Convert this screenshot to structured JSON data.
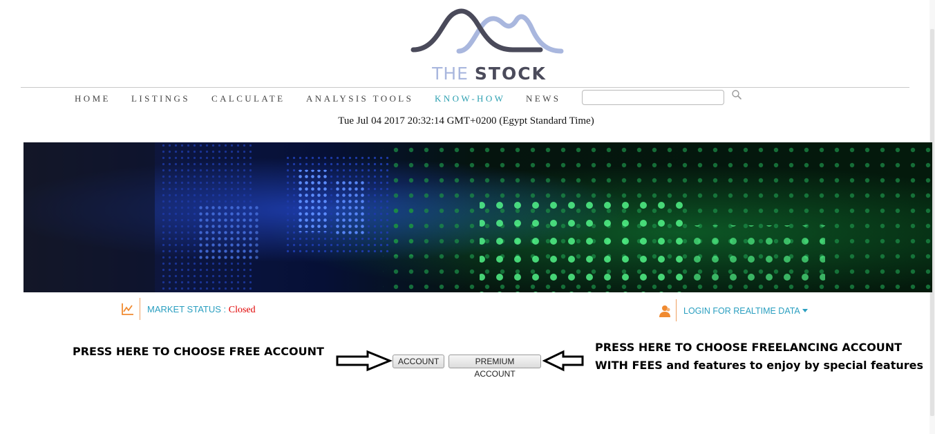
{
  "brand": {
    "prefix": "THE",
    "name": "STOCK",
    "logo_colors": {
      "dark": "#4a4a5a",
      "light": "#a9b7de"
    }
  },
  "nav": {
    "items": [
      {
        "label": "HOME",
        "active": false
      },
      {
        "label": "LISTINGS",
        "active": false
      },
      {
        "label": "CALCULATE",
        "active": false
      },
      {
        "label": "ANALYSIS TOOLS",
        "active": false
      },
      {
        "label": "KNOW-HOW",
        "active": true
      },
      {
        "label": "NEWS",
        "active": false
      }
    ],
    "active_color": "#2a9fb0"
  },
  "search": {
    "value": "",
    "icon": "search-icon"
  },
  "datetime": "Tue Jul 04 2017 20:32:14 GMT+0200 (Egypt Standard Time)",
  "banner": {
    "icon": "stock-ticker-led-image"
  },
  "market": {
    "icon": "line-chart-icon",
    "label": "MARKET STATUS",
    "separator": " : ",
    "value": "Closed",
    "value_color": "#e00000"
  },
  "login": {
    "icon": "user-icon",
    "label": "LOGIN FOR REALTIME DATA",
    "caret_icon": "caret-down-icon"
  },
  "annotations": {
    "left": "PRESS HERE TO CHOOSE FREE ACCOUNT",
    "right_line1": "PRESS HERE TO CHOOSE FREELANCING ACCOUNT",
    "right_line2": "WITH FEES and features to enjoy by special features"
  },
  "buttons": {
    "account": "ACCOUNT",
    "premium": "PREMIUM ACCOUNT"
  },
  "colors": {
    "accent": "#2a9fc0",
    "icon_orange": "#f08a30"
  }
}
